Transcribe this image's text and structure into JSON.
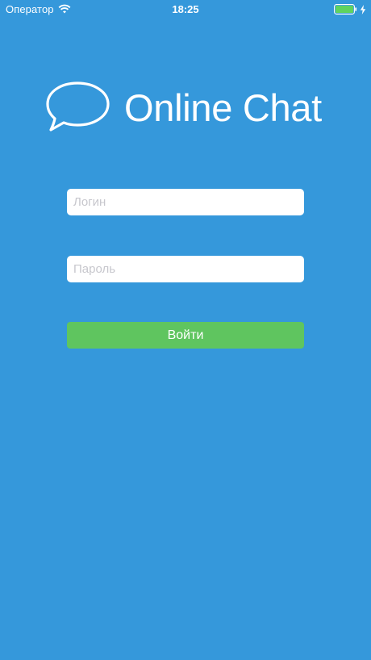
{
  "status_bar": {
    "carrier": "Оператор",
    "time": "18:25",
    "wifi_icon": "wifi-icon",
    "battery_icon": "battery-icon",
    "charging_icon": "charging-bolt-icon",
    "battery_level": 1.0
  },
  "app": {
    "title": "Online Chat",
    "logo_icon": "chat-bubble-icon"
  },
  "form": {
    "login_placeholder": "Логин",
    "login_value": "",
    "password_placeholder": "Пароль",
    "password_value": "",
    "submit_label": "Войти"
  },
  "colors": {
    "background": "#3598db",
    "button": "#5fc55f",
    "field": "#ffffff",
    "battery": "#5fd35f"
  }
}
